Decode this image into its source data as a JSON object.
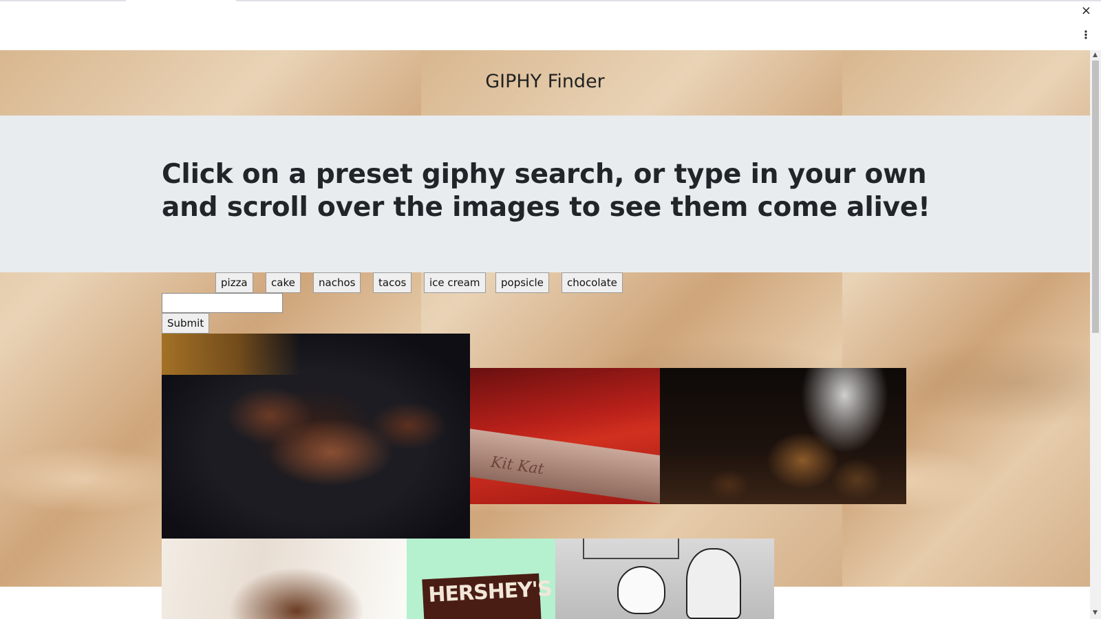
{
  "browser": {
    "close_icon": "close-icon",
    "menu_icon": "kebab-menu-icon",
    "close_glyph": "×",
    "menu_glyph": "⋮"
  },
  "header": {
    "title": "GIPHY Finder"
  },
  "jumbotron": {
    "heading": "Click on a preset giphy search, or type in your own and scroll over the images to see them come alive!"
  },
  "presets": [
    {
      "label": "pizza"
    },
    {
      "label": "cake"
    },
    {
      "label": "nachos"
    },
    {
      "label": "tacos"
    },
    {
      "label": "ice cream"
    },
    {
      "label": "popsicle"
    },
    {
      "label": "chocolate"
    }
  ],
  "search": {
    "value": "",
    "placeholder": "",
    "submit_label": "Submit"
  },
  "gifs": [
    {
      "subject": "chocolate frosted brownies on black plate"
    },
    {
      "subject": "Kit Kat bar on red background",
      "visible_text": "Kit Kat"
    },
    {
      "subject": "chocolate poured over cream puffs"
    },
    {
      "subject": "chocolate dipped in milk"
    },
    {
      "subject": "Hershey's bar on mint background",
      "visible_text": "HERSHEY'S"
    },
    {
      "subject": "cartoon dog and man on couch"
    }
  ],
  "colors": {
    "jumbotron_bg": "#e9ecef",
    "heading_text": "#212529",
    "button_bg": "#efefef",
    "button_border": "#9a9a9a"
  }
}
